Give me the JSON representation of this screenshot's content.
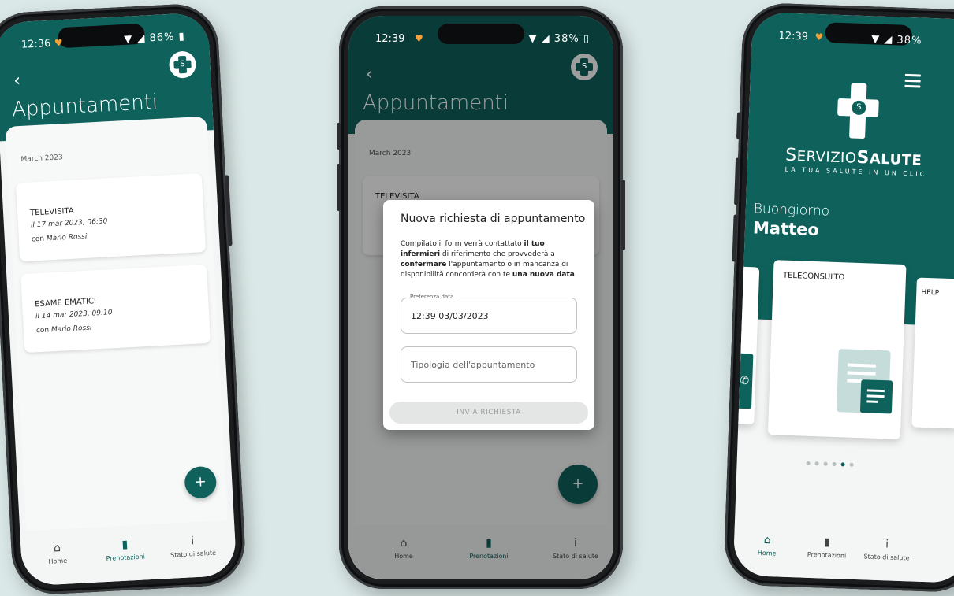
{
  "colors": {
    "teal": "#0f625c",
    "accent_heart": "#f3a23b"
  },
  "phone1": {
    "status": {
      "time": "12:36",
      "battery": "86%"
    },
    "title": "Appuntamenti",
    "month": "March 2023",
    "appointments": [
      {
        "type": "TELEVISITA",
        "date": "il 17 mar 2023, 06:30",
        "with_prefix": "con",
        "with_name": "Mario Rossi"
      },
      {
        "type": "ESAME EMATICI",
        "date": "il 14 mar 2023, 09:10",
        "with_prefix": "con",
        "with_name": "Mario Rossi"
      }
    ],
    "fab": "+",
    "nav": [
      {
        "label": "Home",
        "icon": "home-icon"
      },
      {
        "label": "Prenotazioni",
        "icon": "bookmark-icon"
      },
      {
        "label": "Stato di salute",
        "icon": "person-icon"
      }
    ],
    "active_nav": "Prenotazioni"
  },
  "phone2": {
    "status": {
      "time": "12:39",
      "battery": "38%"
    },
    "title": "Appuntamenti",
    "month": "March 2023",
    "behind_item": "TELEVISITA",
    "dialog": {
      "title": "Nuova richiesta di appuntamento",
      "text_1": "Compilato il form verrà contattato ",
      "text_bold_1": "il tuo infermieri",
      "text_2": " di riferimento che provvederà a ",
      "text_bold_2": "confermare",
      "text_3": " l'appuntamento o in mancanza di disponibilità concorderà con te ",
      "text_bold_3": "una nuova data",
      "date_label": "Preferenza data",
      "date_value": "12:39 03/03/2023",
      "type_placeholder": "Tipologia dell'appuntamento",
      "send_label": "INVIA RICHIESTA"
    },
    "fab": "+",
    "nav": [
      {
        "label": "Home"
      },
      {
        "label": "Prenotazioni"
      },
      {
        "label": "Stato di salute"
      }
    ]
  },
  "phone3": {
    "status": {
      "time": "12:39",
      "battery": "38%"
    },
    "brand_a": "S",
    "brand_b": "ERVIZIO",
    "brand_c": "S",
    "brand_d": "ALUTE",
    "tagline": "LA TUA SALUTE IN UN CLIC",
    "greeting": "Buongiorno",
    "user": "Matteo",
    "card_main": "TELECONSULTO",
    "card_right": "HELP",
    "carousel_active_index": 4,
    "carousel_count": 6,
    "nav": [
      {
        "label": "Home"
      },
      {
        "label": "Prenotazioni"
      },
      {
        "label": "Stato di salute"
      }
    ]
  }
}
